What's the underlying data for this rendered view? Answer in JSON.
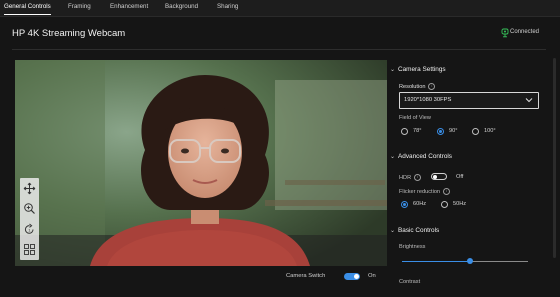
{
  "tabs": [
    {
      "label": "General Controls",
      "active": true
    },
    {
      "label": "Framing",
      "active": false
    },
    {
      "label": "Enhancement",
      "active": false
    },
    {
      "label": "Background",
      "active": false
    },
    {
      "label": "Sharing",
      "active": false
    }
  ],
  "header": {
    "title": "HP 4K Streaming Webcam",
    "status": "Connected",
    "status_color": "#37c25a"
  },
  "video_tools": [
    "move-icon",
    "zoom-in-icon",
    "rotate-icon",
    "grid-icon"
  ],
  "camera_switch": {
    "label": "Camera Switch",
    "state": "On",
    "on": true
  },
  "camera_settings": {
    "heading": "Camera Settings",
    "resolution_label": "Resolution",
    "resolution_value": "1920*1080 30FPS",
    "fov_label": "Field of View",
    "fov_options": [
      "78°",
      "90°",
      "100°"
    ],
    "fov_selected": "90°"
  },
  "advanced_controls": {
    "heading": "Advanced Controls",
    "hdr_label": "HDR",
    "hdr_state": "Off",
    "flicker_label": "Flicker reduction",
    "flicker_options": [
      "60Hz",
      "50Hz"
    ],
    "flicker_selected": "60Hz"
  },
  "basic_controls": {
    "heading": "Basic Controls",
    "brightness_label": "Brightness",
    "brightness_level": 0.54,
    "contrast_label": "Contrast"
  },
  "colors": {
    "accent": "#3a8ee6",
    "background": "#151515"
  }
}
